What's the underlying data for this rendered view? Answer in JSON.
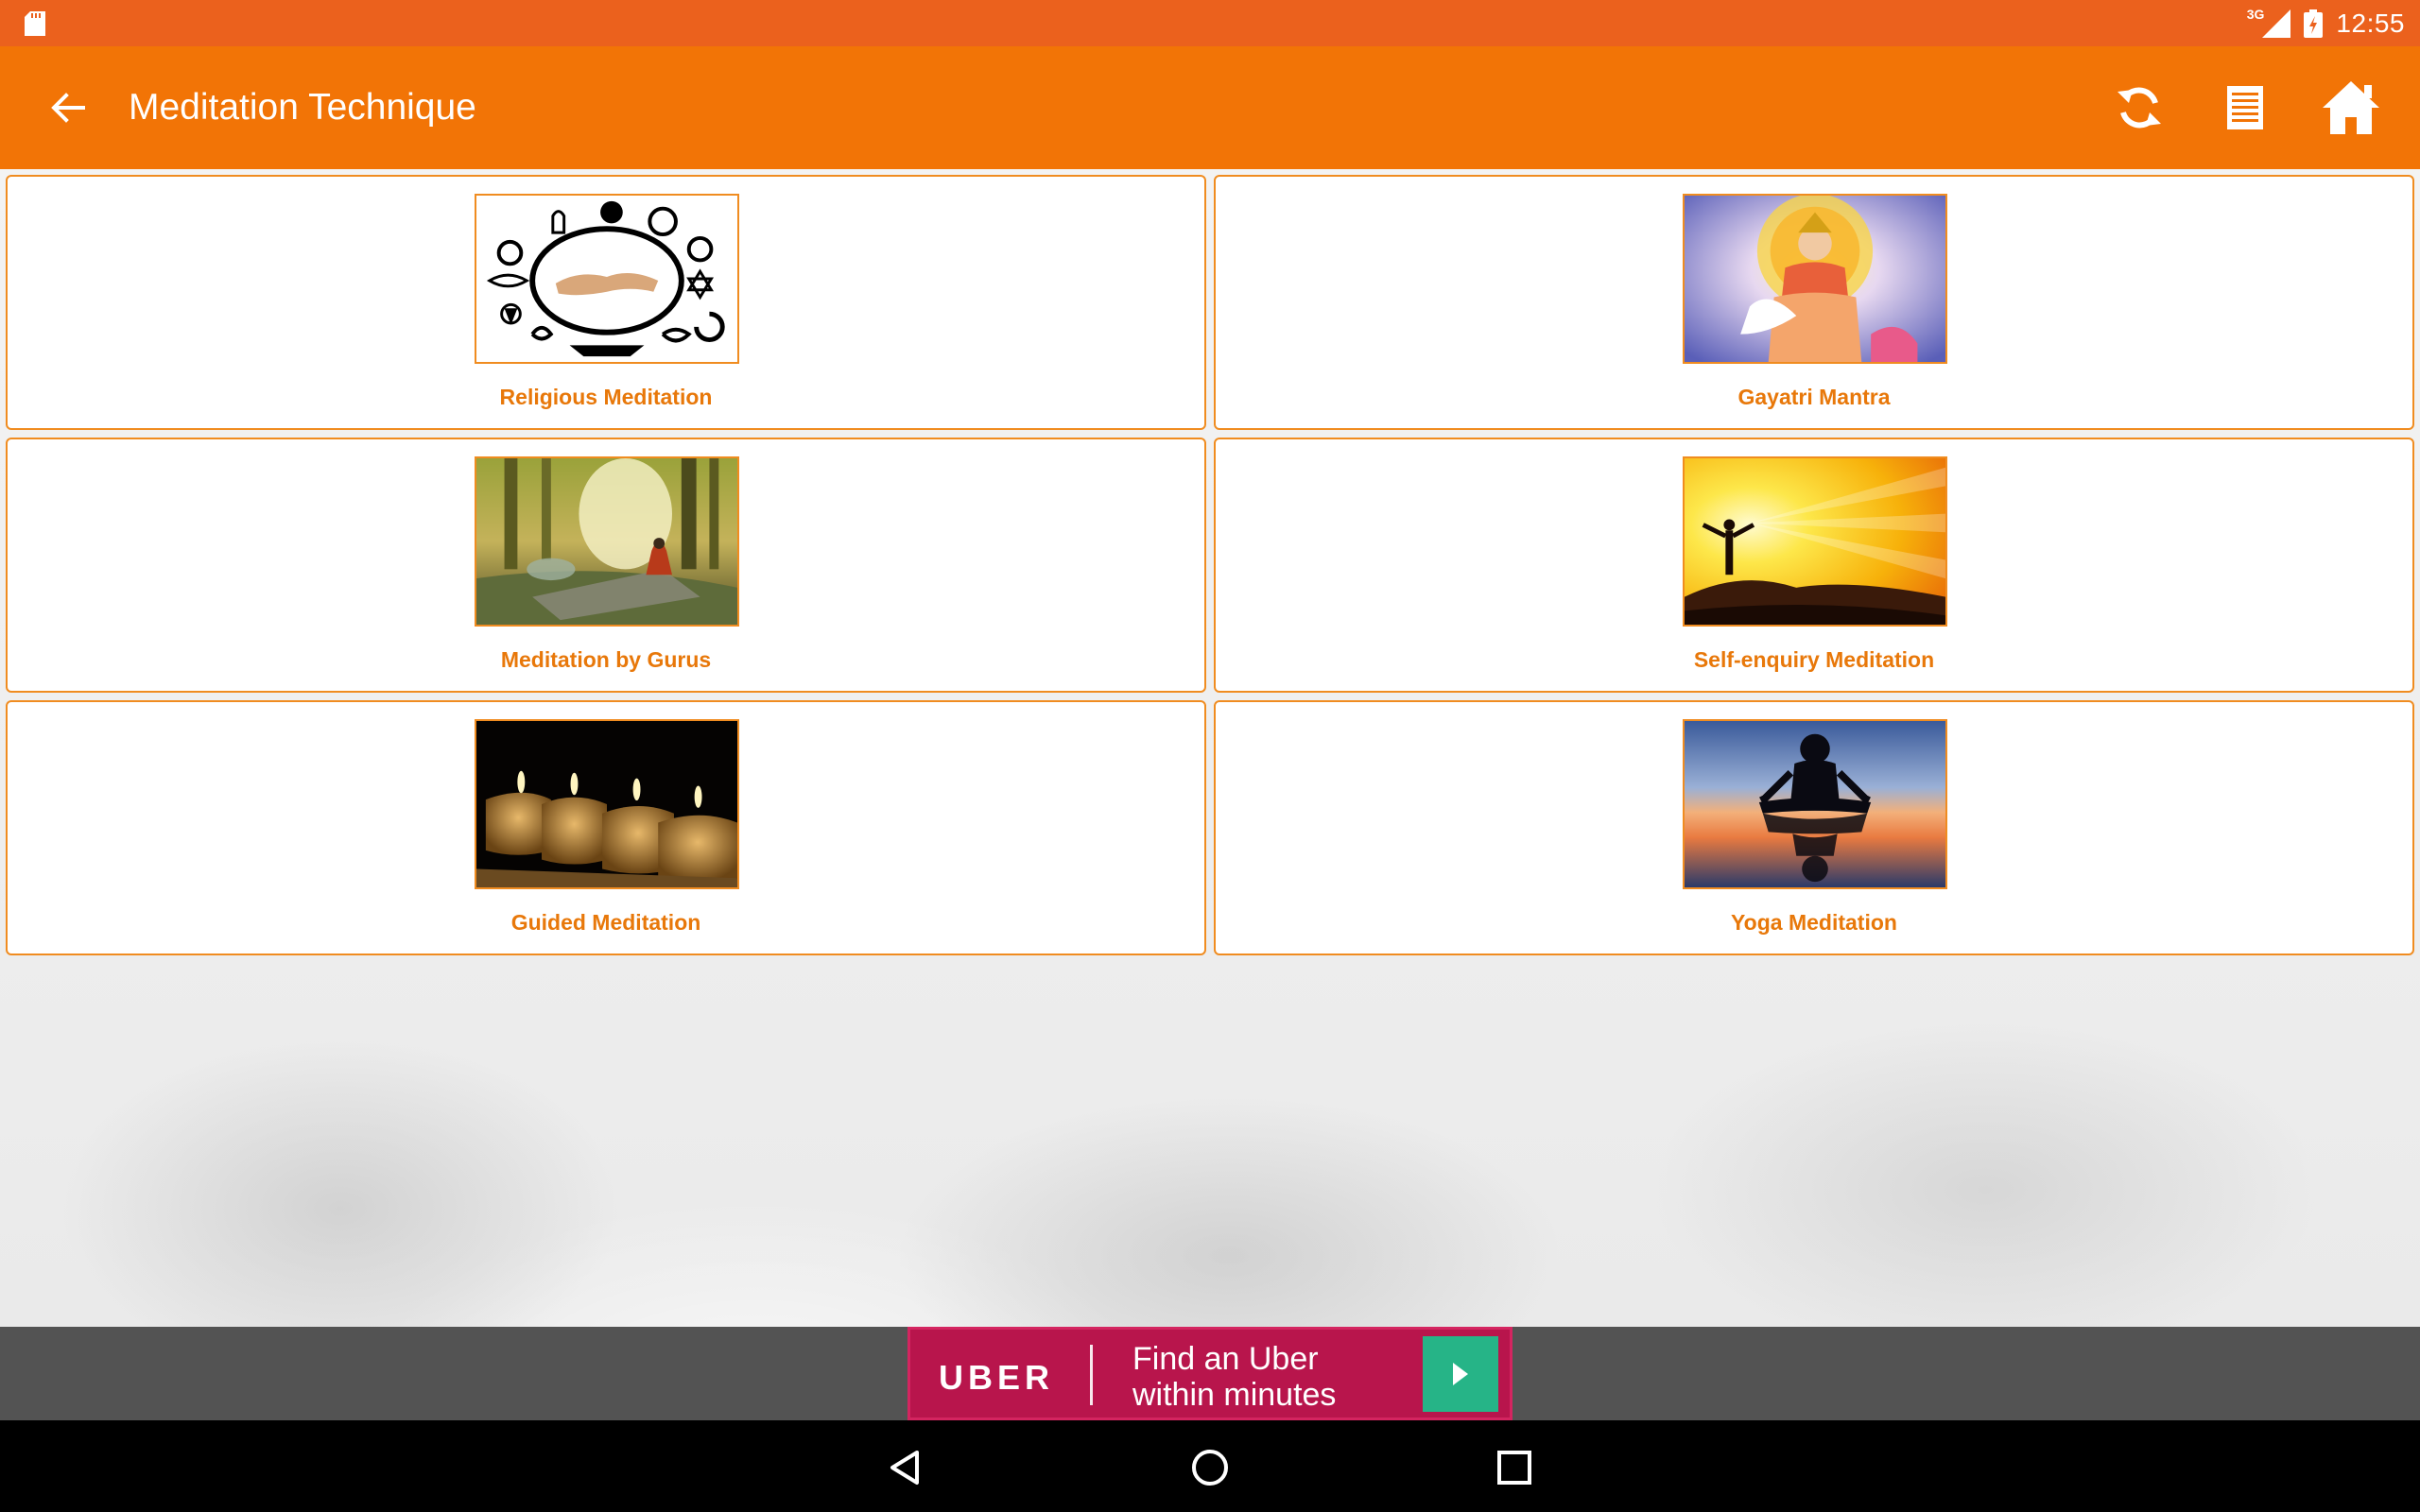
{
  "status_bar": {
    "network": "3G",
    "time": "12:55"
  },
  "app_bar": {
    "title": "Meditation Technique"
  },
  "items": [
    {
      "label": "Religious Meditation"
    },
    {
      "label": "Gayatri Mantra"
    },
    {
      "label": "Meditation by Gurus"
    },
    {
      "label": "Self-enquiry Meditation"
    },
    {
      "label": "Guided Meditation"
    },
    {
      "label": "Yoga Meditation"
    }
  ],
  "ad": {
    "brand": "UBER",
    "line1": "Find an Uber",
    "line2": "within minutes"
  },
  "colors": {
    "status_bar": "#eb611d",
    "app_bar": "#f27406",
    "accent": "#e8780a",
    "ad_background": "#b8154c",
    "ad_button": "#26b487"
  }
}
